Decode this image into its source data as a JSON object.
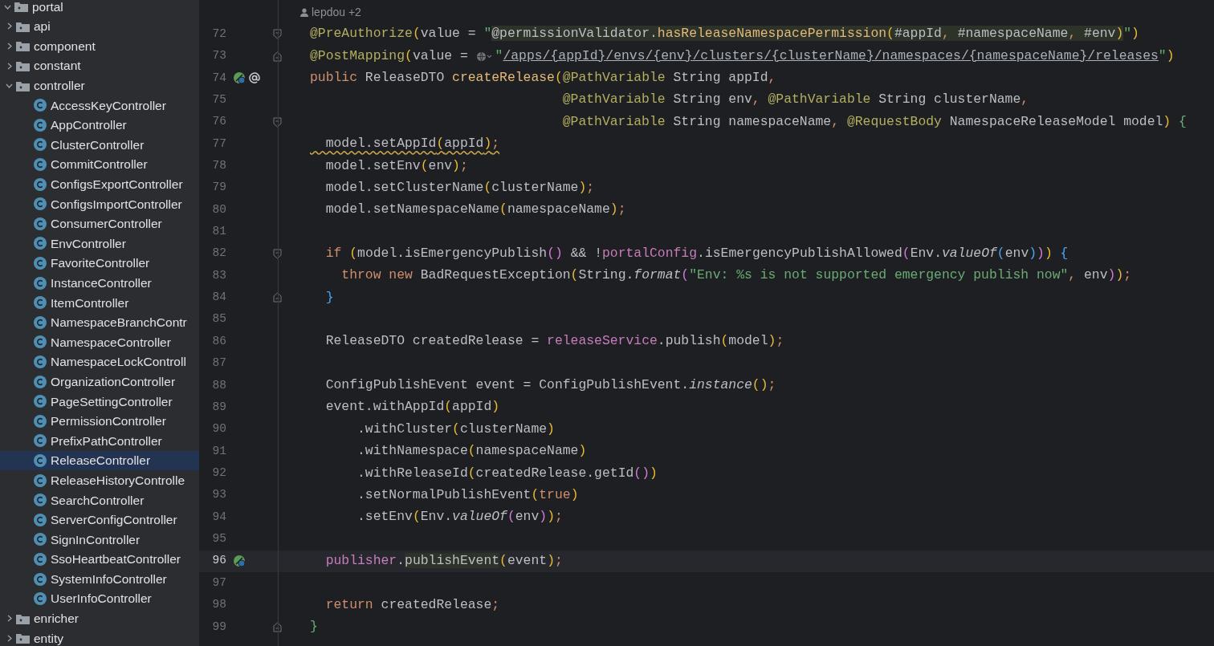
{
  "project_tree": [
    {
      "label": "portal",
      "kind": "folder",
      "expanded": true,
      "selected": false,
      "children": [
        {
          "label": "api",
          "kind": "folder",
          "expanded": false,
          "selected": false
        },
        {
          "label": "component",
          "kind": "folder",
          "expanded": false,
          "selected": false
        },
        {
          "label": "constant",
          "kind": "folder",
          "expanded": false,
          "selected": false
        },
        {
          "label": "controller",
          "kind": "folder",
          "expanded": true,
          "selected": false,
          "children": [
            {
              "label": "AccessKeyController",
              "kind": "class",
              "selected": false
            },
            {
              "label": "AppController",
              "kind": "class",
              "selected": false
            },
            {
              "label": "ClusterController",
              "kind": "class",
              "selected": false
            },
            {
              "label": "CommitController",
              "kind": "class",
              "selected": false
            },
            {
              "label": "ConfigsExportController",
              "kind": "class",
              "selected": false
            },
            {
              "label": "ConfigsImportController",
              "kind": "class",
              "selected": false
            },
            {
              "label": "ConsumerController",
              "kind": "class",
              "selected": false
            },
            {
              "label": "EnvController",
              "kind": "class",
              "selected": false
            },
            {
              "label": "FavoriteController",
              "kind": "class",
              "selected": false
            },
            {
              "label": "InstanceController",
              "kind": "class",
              "selected": false
            },
            {
              "label": "ItemController",
              "kind": "class",
              "selected": false
            },
            {
              "label": "NamespaceBranchContr",
              "kind": "class",
              "selected": false
            },
            {
              "label": "NamespaceController",
              "kind": "class",
              "selected": false
            },
            {
              "label": "NamespaceLockControll",
              "kind": "class",
              "selected": false
            },
            {
              "label": "OrganizationController",
              "kind": "class",
              "selected": false
            },
            {
              "label": "PageSettingController",
              "kind": "class",
              "selected": false
            },
            {
              "label": "PermissionController",
              "kind": "class",
              "selected": false
            },
            {
              "label": "PrefixPathController",
              "kind": "class",
              "selected": false
            },
            {
              "label": "ReleaseController",
              "kind": "class",
              "selected": true
            },
            {
              "label": "ReleaseHistoryControlle",
              "kind": "class",
              "selected": false
            },
            {
              "label": "SearchController",
              "kind": "class",
              "selected": false
            },
            {
              "label": "ServerConfigController",
              "kind": "class",
              "selected": false
            },
            {
              "label": "SignInController",
              "kind": "class",
              "selected": false
            },
            {
              "label": "SsoHeartbeatController",
              "kind": "class",
              "selected": false
            },
            {
              "label": "SystemInfoController",
              "kind": "class",
              "selected": false
            },
            {
              "label": "UserInfoController",
              "kind": "class",
              "selected": false
            }
          ]
        },
        {
          "label": "enricher",
          "kind": "folder",
          "expanded": false,
          "selected": false
        },
        {
          "label": "entity",
          "kind": "folder",
          "expanded": false,
          "selected": false
        }
      ]
    }
  ],
  "editor": {
    "author_hint": "lepdou +2",
    "lines": [
      {
        "number": "72",
        "fold_start": true,
        "tokens": [
          {
            "kind": "ann",
            "text": "@PreAuthorize"
          },
          {
            "kind": "p1",
            "text": "("
          },
          {
            "kind": "t",
            "text": "value = "
          },
          {
            "kind": "str",
            "text": "\""
          },
          {
            "kind": "t",
            "text": "@permissionValidator",
            "injected": true
          },
          {
            "kind": "t",
            "text": ".",
            "injected": true
          },
          {
            "kind": "fn",
            "text": "hasReleaseNamespacePermission",
            "injected": true
          },
          {
            "kind": "p1",
            "text": "(",
            "injected": true
          },
          {
            "kind": "t",
            "text": "#appId",
            "injected": true
          },
          {
            "kind": "punct",
            "text": ", ",
            "injected": true
          },
          {
            "kind": "t",
            "text": "#namespaceName",
            "injected": true
          },
          {
            "kind": "punct",
            "text": ", ",
            "injected": true
          },
          {
            "kind": "t",
            "text": "#env",
            "injected": true
          },
          {
            "kind": "p1",
            "text": ")",
            "injected": true
          },
          {
            "kind": "str",
            "text": "\""
          },
          {
            "kind": "p1",
            "text": ")"
          }
        ]
      },
      {
        "number": "73",
        "fold_end": true,
        "tokens": [
          {
            "kind": "ann",
            "text": "@PostMapping"
          },
          {
            "kind": "p1",
            "text": "("
          },
          {
            "kind": "t",
            "text": "value = "
          },
          {
            "kind": "globe"
          },
          {
            "kind": "str",
            "text": "\""
          },
          {
            "kind": "url",
            "text": "/apps/{appId}/envs/{env}/clusters/{clusterName}/namespaces/{namespaceName}/releases"
          },
          {
            "kind": "str",
            "text": "\""
          },
          {
            "kind": "p1",
            "text": ")"
          }
        ]
      },
      {
        "number": "74",
        "bean_icon": true,
        "at_icon": true,
        "tokens": [
          {
            "kind": "kw",
            "text": "public"
          },
          {
            "kind": "t",
            "text": " ReleaseDTO "
          },
          {
            "kind": "fn",
            "text": "createRelease"
          },
          {
            "kind": "p1",
            "text": "("
          },
          {
            "kind": "ann",
            "text": "@PathVariable"
          },
          {
            "kind": "t",
            "text": " String appId"
          },
          {
            "kind": "punct",
            "text": ","
          }
        ]
      },
      {
        "number": "75",
        "tokens": [
          {
            "kind": "ann",
            "text": "                                @PathVariable"
          },
          {
            "kind": "t",
            "text": " String env"
          },
          {
            "kind": "punct",
            "text": ", "
          },
          {
            "kind": "ann",
            "text": "@PathVariable"
          },
          {
            "kind": "t",
            "text": " String clusterName"
          },
          {
            "kind": "punct",
            "text": ","
          }
        ]
      },
      {
        "number": "76",
        "fold_start": true,
        "tokens": [
          {
            "kind": "ann",
            "text": "                                @PathVariable"
          },
          {
            "kind": "t",
            "text": " String namespaceName"
          },
          {
            "kind": "punct",
            "text": ", "
          },
          {
            "kind": "ann",
            "text": "@RequestBody"
          },
          {
            "kind": "t",
            "text": " NamespaceReleaseModel model"
          },
          {
            "kind": "p1",
            "text": ")"
          },
          {
            "kind": "brace",
            "text": " {"
          }
        ]
      },
      {
        "number": "77",
        "warning": true,
        "tokens": [
          {
            "kind": "t",
            "text": "  model.setAppId"
          },
          {
            "kind": "p1",
            "text": "("
          },
          {
            "kind": "t",
            "text": "appId"
          },
          {
            "kind": "p1",
            "text": ")"
          },
          {
            "kind": "punct",
            "text": ";"
          }
        ]
      },
      {
        "number": "78",
        "tokens": [
          {
            "kind": "t",
            "text": "  model.setEnv"
          },
          {
            "kind": "p1",
            "text": "("
          },
          {
            "kind": "t",
            "text": "env"
          },
          {
            "kind": "p1",
            "text": ")"
          },
          {
            "kind": "punct",
            "text": ";"
          }
        ]
      },
      {
        "number": "79",
        "tokens": [
          {
            "kind": "t",
            "text": "  model.setClusterName"
          },
          {
            "kind": "p1",
            "text": "("
          },
          {
            "kind": "t",
            "text": "clusterName"
          },
          {
            "kind": "p1",
            "text": ")"
          },
          {
            "kind": "punct",
            "text": ";"
          }
        ]
      },
      {
        "number": "80",
        "tokens": [
          {
            "kind": "t",
            "text": "  model.setNamespaceName"
          },
          {
            "kind": "p1",
            "text": "("
          },
          {
            "kind": "t",
            "text": "namespaceName"
          },
          {
            "kind": "p1",
            "text": ")"
          },
          {
            "kind": "punct",
            "text": ";"
          }
        ]
      },
      {
        "number": "81"
      },
      {
        "number": "82",
        "fold_start": true,
        "tokens": [
          {
            "kind": "kw",
            "text": "  if"
          },
          {
            "kind": "p1",
            "text": " ("
          },
          {
            "kind": "t",
            "text": "model.isEmergencyPublish"
          },
          {
            "kind": "p2",
            "text": "()"
          },
          {
            "kind": "t",
            "text": " && !"
          },
          {
            "kind": "fld",
            "text": "portalConfig"
          },
          {
            "kind": "t",
            "text": ".isEmergencyPublishAllowed"
          },
          {
            "kind": "p2",
            "text": "("
          },
          {
            "kind": "t",
            "text": "Env."
          },
          {
            "kind": "it",
            "text": "valueOf"
          },
          {
            "kind": "p3",
            "text": "("
          },
          {
            "kind": "t",
            "text": "env"
          },
          {
            "kind": "p3",
            "text": ")"
          },
          {
            "kind": "p2",
            "text": ")"
          },
          {
            "kind": "p1",
            "text": ")"
          },
          {
            "kind": "p3",
            "text": " {"
          }
        ]
      },
      {
        "number": "83",
        "tokens": [
          {
            "kind": "kw",
            "text": "    throw new"
          },
          {
            "kind": "t",
            "text": " BadRequestException"
          },
          {
            "kind": "p1",
            "text": "("
          },
          {
            "kind": "t",
            "text": "String."
          },
          {
            "kind": "it",
            "text": "format"
          },
          {
            "kind": "p2",
            "text": "("
          },
          {
            "kind": "str",
            "text": "\"Env: %s is not supported emergency publish now\""
          },
          {
            "kind": "punct",
            "text": ","
          },
          {
            "kind": "t",
            "text": " env"
          },
          {
            "kind": "p2",
            "text": ")"
          },
          {
            "kind": "p1",
            "text": ")"
          },
          {
            "kind": "punct",
            "text": ";"
          }
        ]
      },
      {
        "number": "84",
        "fold_end": true,
        "tokens": [
          {
            "kind": "p3",
            "text": "  }"
          }
        ]
      },
      {
        "number": "85"
      },
      {
        "number": "86",
        "tokens": [
          {
            "kind": "t",
            "text": "  ReleaseDTO createdRelease = "
          },
          {
            "kind": "fld",
            "text": "releaseService"
          },
          {
            "kind": "t",
            "text": ".publish"
          },
          {
            "kind": "p1",
            "text": "("
          },
          {
            "kind": "t",
            "text": "model"
          },
          {
            "kind": "p1",
            "text": ")"
          },
          {
            "kind": "punct",
            "text": ";"
          }
        ]
      },
      {
        "number": "87"
      },
      {
        "number": "88",
        "tokens": [
          {
            "kind": "t",
            "text": "  ConfigPublishEvent event = ConfigPublishEvent."
          },
          {
            "kind": "it",
            "text": "instance"
          },
          {
            "kind": "p1",
            "text": "()"
          },
          {
            "kind": "punct",
            "text": ";"
          }
        ]
      },
      {
        "number": "89",
        "tokens": [
          {
            "kind": "t",
            "text": "  event.withAppId"
          },
          {
            "kind": "p1",
            "text": "("
          },
          {
            "kind": "t",
            "text": "appId"
          },
          {
            "kind": "p1",
            "text": ")"
          }
        ]
      },
      {
        "number": "90",
        "tokens": [
          {
            "kind": "t",
            "text": "      .withCluster"
          },
          {
            "kind": "p1",
            "text": "("
          },
          {
            "kind": "t",
            "text": "clusterName"
          },
          {
            "kind": "p1",
            "text": ")"
          }
        ]
      },
      {
        "number": "91",
        "tokens": [
          {
            "kind": "t",
            "text": "      .withNamespace"
          },
          {
            "kind": "p1",
            "text": "("
          },
          {
            "kind": "t",
            "text": "namespaceName"
          },
          {
            "kind": "p1",
            "text": ")"
          }
        ]
      },
      {
        "number": "92",
        "tokens": [
          {
            "kind": "t",
            "text": "      .withReleaseId"
          },
          {
            "kind": "p1",
            "text": "("
          },
          {
            "kind": "t",
            "text": "createdRelease.getId"
          },
          {
            "kind": "p2",
            "text": "()"
          },
          {
            "kind": "p1",
            "text": ")"
          }
        ]
      },
      {
        "number": "93",
        "tokens": [
          {
            "kind": "t",
            "text": "      .setNormalPublishEvent"
          },
          {
            "kind": "p1",
            "text": "("
          },
          {
            "kind": "kw",
            "text": "true"
          },
          {
            "kind": "p1",
            "text": ")"
          }
        ]
      },
      {
        "number": "94",
        "tokens": [
          {
            "kind": "t",
            "text": "      .setEnv"
          },
          {
            "kind": "p1",
            "text": "("
          },
          {
            "kind": "t",
            "text": "Env."
          },
          {
            "kind": "it",
            "text": "valueOf"
          },
          {
            "kind": "p2",
            "text": "("
          },
          {
            "kind": "t",
            "text": "env"
          },
          {
            "kind": "p2",
            "text": ")"
          },
          {
            "kind": "p1",
            "text": ")"
          },
          {
            "kind": "punct",
            "text": ";"
          }
        ]
      },
      {
        "number": "95"
      },
      {
        "number": "96",
        "current": true,
        "bean_icon": true,
        "tokens": [
          {
            "kind": "fld",
            "text": "  publisher"
          },
          {
            "kind": "t",
            "text": "."
          },
          {
            "kind": "t",
            "text": "publishEvent",
            "injected": true
          },
          {
            "kind": "p1",
            "text": "("
          },
          {
            "kind": "t",
            "text": "event"
          },
          {
            "kind": "p1",
            "text": ")"
          },
          {
            "kind": "punct",
            "text": ";"
          }
        ]
      },
      {
        "number": "97"
      },
      {
        "number": "98",
        "tokens": [
          {
            "kind": "kw",
            "text": "  return"
          },
          {
            "kind": "t",
            "text": " createdRelease"
          },
          {
            "kind": "punct",
            "text": ";"
          }
        ]
      },
      {
        "number": "99",
        "fold_end": true,
        "tokens": [
          {
            "kind": "brace",
            "text": "}"
          }
        ]
      }
    ]
  }
}
